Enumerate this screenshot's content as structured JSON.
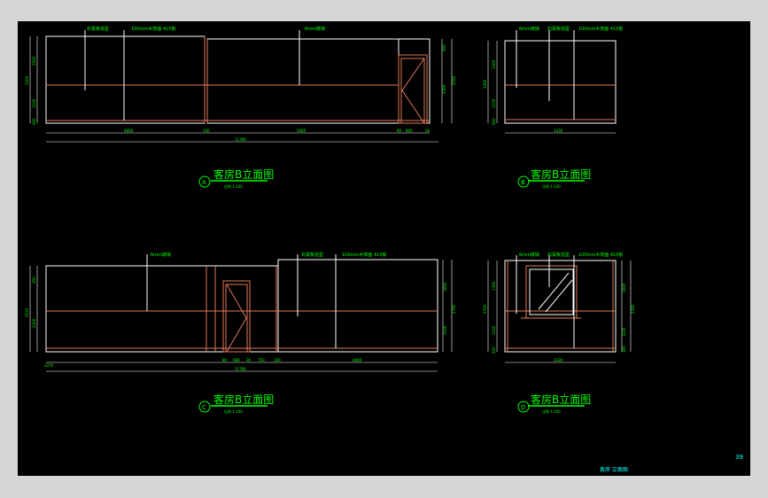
{
  "colors": {
    "background": "#000000",
    "frame": "#d6d6d6",
    "outline": "#ffffff",
    "band": "#e07a5a",
    "door": "#e07a5a",
    "annotation": "#00ff00",
    "title_underline": "#00ff00"
  },
  "elevations": {
    "top_left": {
      "callouts": [
        "石膏板造型",
        "100mm木饰面 415板",
        "6mm玻璃"
      ],
      "width_labels": [
        "4800",
        "100",
        "5660",
        "80",
        "800",
        "30"
      ],
      "total_width": "11780",
      "height_labels": [
        "2500",
        "1100",
        "400",
        "2300"
      ],
      "right_height_labels": [
        "450",
        "2300",
        "2550"
      ],
      "title": "客房B立面图",
      "scale": "比例 1:100",
      "marker": "A"
    },
    "top_right": {
      "callouts": [
        "6mm玻璃",
        "石膏板造型",
        "100mm木饰面 415板"
      ],
      "width_labels": [
        "3330"
      ],
      "height_labels": [
        "1300",
        "1100",
        "400",
        "2300"
      ],
      "title": "客房B立面图",
      "scale": "比例 1:100",
      "marker": "B"
    },
    "bottom_left": {
      "callouts": [
        "6mm玻璃",
        "石膏板造型",
        "100mm木饰面 415板"
      ],
      "width_labels": [
        "80",
        "680",
        "30",
        "750",
        "100",
        "4800"
      ],
      "left_width_label": "3370",
      "total_width": "11780",
      "height_labels": [
        "450",
        "2300",
        "2510"
      ],
      "right_height_labels": [
        "1600",
        "1100",
        "2700"
      ],
      "title": "客房B立面图",
      "scale": "比例 1:100",
      "marker": "C"
    },
    "bottom_right": {
      "callouts": [
        "6mm玻璃",
        "石膏板造型",
        "100mm木饰面 415板"
      ],
      "width_labels": [
        "3330"
      ],
      "height_labels": [
        "1300",
        "1100",
        "300",
        "2700"
      ],
      "right_height_labels": [
        "1600",
        "1100",
        "300",
        "2300"
      ],
      "title": "客房B立面图",
      "scale": "比例 1:100",
      "marker": "D"
    }
  },
  "sheet": {
    "title": "客房 立面图",
    "page_number": "39"
  }
}
